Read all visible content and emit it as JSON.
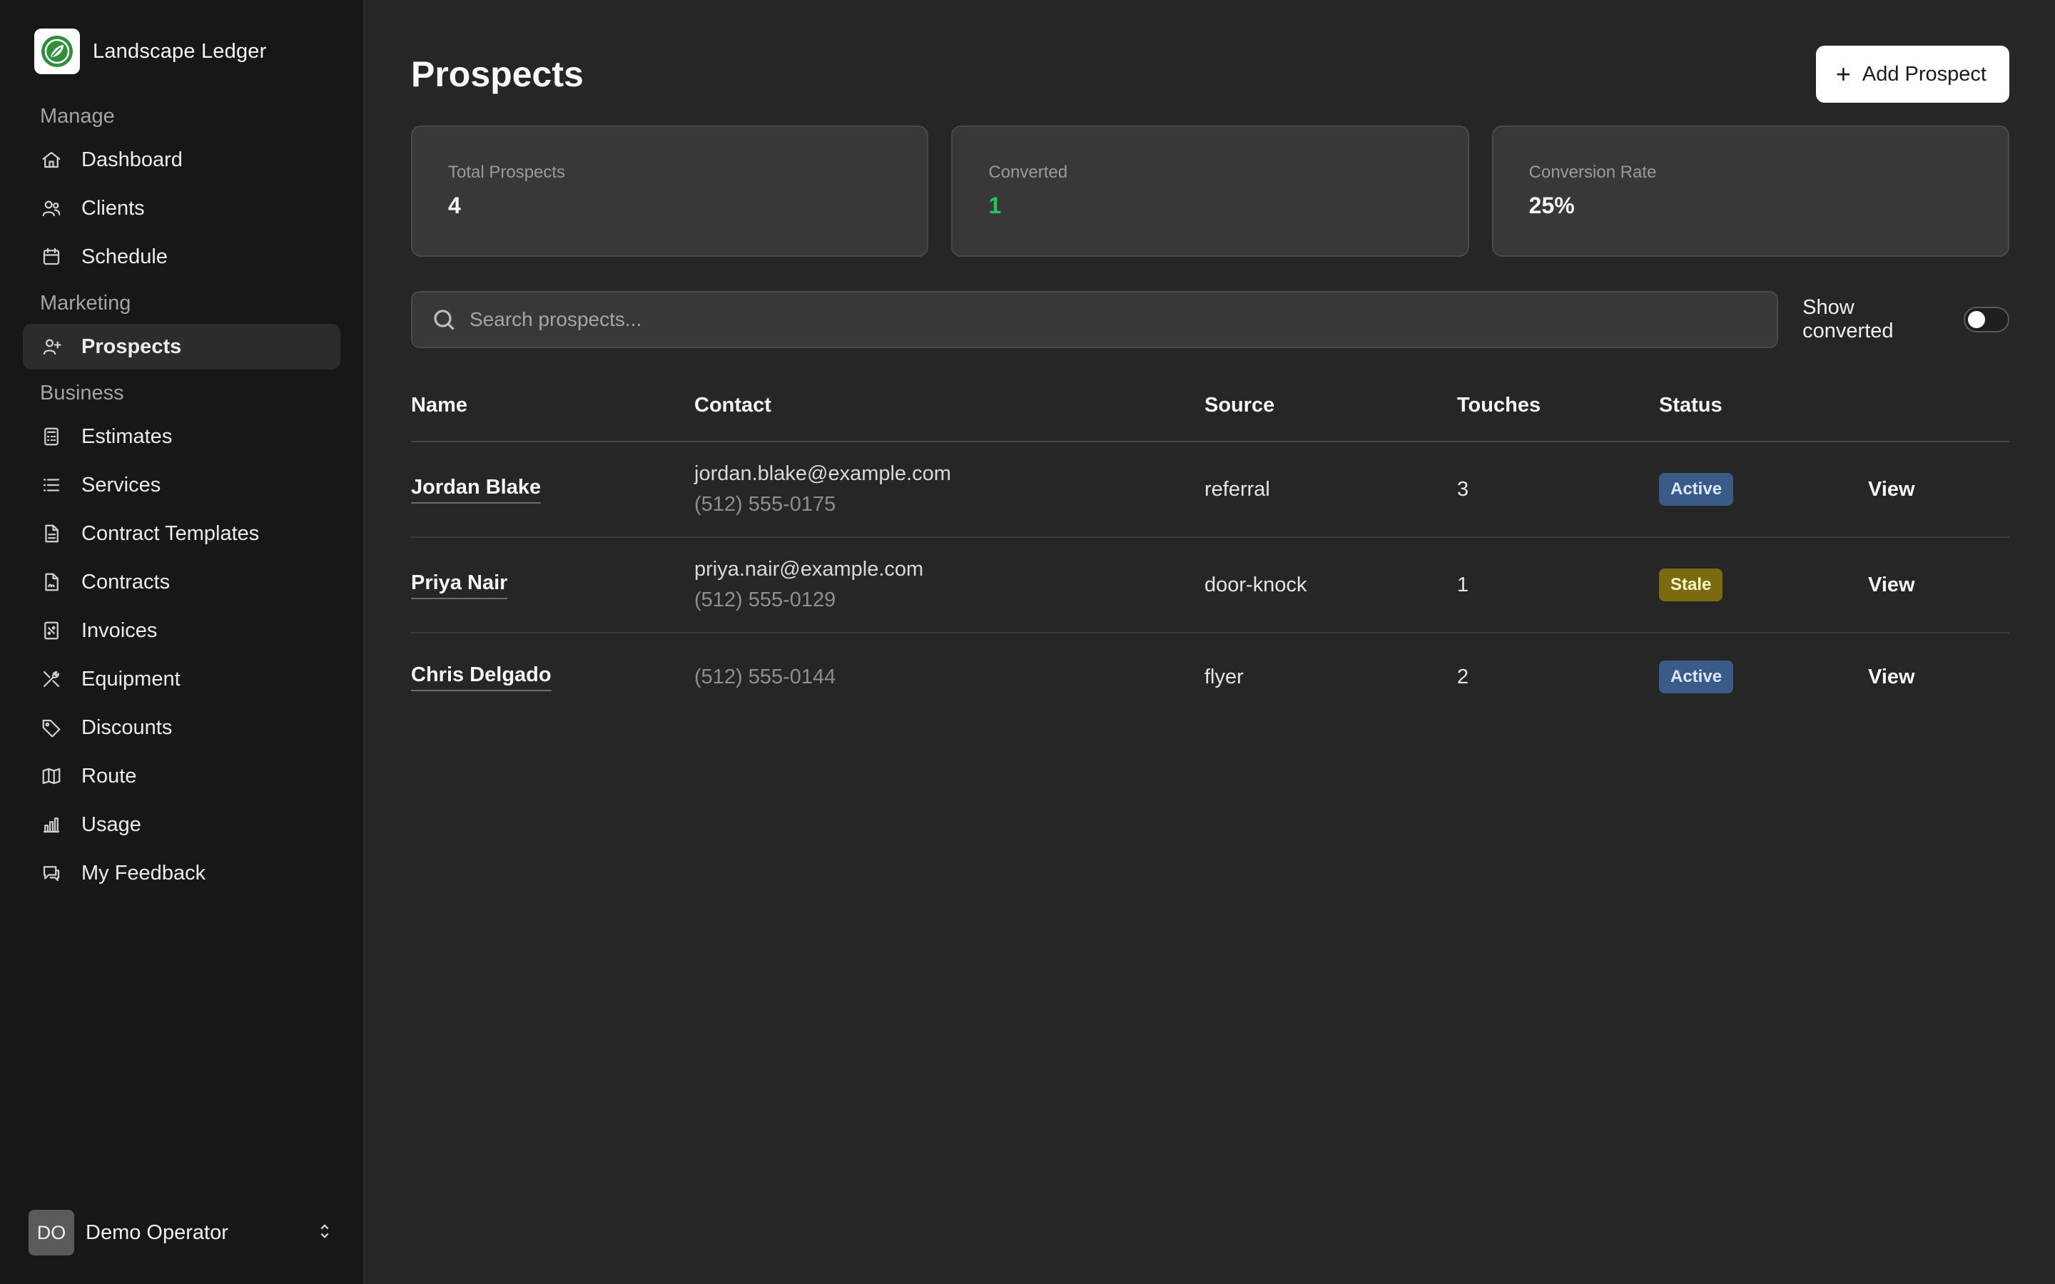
{
  "app": {
    "name": "Landscape Ledger"
  },
  "sidebar": {
    "sections": [
      {
        "label": "Manage",
        "items": [
          {
            "label": "Dashboard",
            "icon": "home-icon"
          },
          {
            "label": "Clients",
            "icon": "users-icon"
          },
          {
            "label": "Schedule",
            "icon": "calendar-icon"
          }
        ]
      },
      {
        "label": "Marketing",
        "items": [
          {
            "label": "Prospects",
            "icon": "user-plus-icon",
            "active": true
          }
        ]
      },
      {
        "label": "Business",
        "items": [
          {
            "label": "Estimates",
            "icon": "calculator-icon"
          },
          {
            "label": "Services",
            "icon": "list-icon"
          },
          {
            "label": "Contract Templates",
            "icon": "file-text-icon"
          },
          {
            "label": "Contracts",
            "icon": "file-signature-icon"
          },
          {
            "label": "Invoices",
            "icon": "receipt-icon"
          },
          {
            "label": "Equipment",
            "icon": "tools-icon"
          },
          {
            "label": "Discounts",
            "icon": "tag-icon"
          },
          {
            "label": "Route",
            "icon": "map-icon"
          },
          {
            "label": "Usage",
            "icon": "bar-chart-icon"
          },
          {
            "label": "My Feedback",
            "icon": "message-icon"
          }
        ]
      }
    ],
    "user": {
      "initials": "DO",
      "name": "Demo Operator"
    }
  },
  "header": {
    "title": "Prospects",
    "add_label": "Add Prospect"
  },
  "stats": [
    {
      "label": "Total Prospects",
      "value": "4"
    },
    {
      "label": "Converted",
      "value": "1"
    },
    {
      "label": "Conversion Rate",
      "value": "25%"
    }
  ],
  "search": {
    "placeholder": "Search prospects...",
    "value": ""
  },
  "toggle": {
    "label": "Show converted",
    "on": false
  },
  "table": {
    "columns": [
      "Name",
      "Contact",
      "Source",
      "Touches",
      "Status",
      ""
    ],
    "rows": [
      {
        "name": "Jordan Blake",
        "email": "jordan.blake@example.com",
        "phone": "(512) 555-0175",
        "source": "referral",
        "touches": "3",
        "status": "Active",
        "action": "View"
      },
      {
        "name": "Priya Nair",
        "email": "priya.nair@example.com",
        "phone": "(512) 555-0129",
        "source": "door-knock",
        "touches": "1",
        "status": "Stale",
        "action": "View"
      },
      {
        "name": "Chris Delgado",
        "email": "",
        "phone": "(512) 555-0144",
        "source": "flyer",
        "touches": "2",
        "status": "Active",
        "action": "View"
      }
    ]
  },
  "colors": {
    "accent_green": "#22c55e",
    "badge_active": "#3a5a87",
    "badge_stale": "#7a6a10"
  }
}
